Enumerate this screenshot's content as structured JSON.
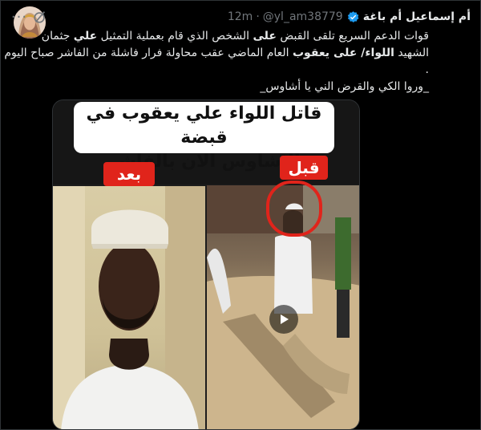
{
  "author": {
    "display_name": "أم إسماعيل أم باغة",
    "handle": "@yl_am38779",
    "separator": "·",
    "time": "12m"
  },
  "icons": {
    "more": "more-icon",
    "grok": "grok-icon",
    "verified": "verified-icon",
    "play": "play-icon"
  },
  "tweet": {
    "lines": [
      [
        "قوات الدعم السريع تلقى القبض ",
        {
          "b": "على"
        },
        " الشخص الذي قام  بعملية التمثيل ",
        {
          "b": "علي"
        },
        " جثمان"
      ],
      [
        "الشهيد ",
        {
          "b": "اللواء/ على يعقوب"
        },
        " العام الماضي عقب محاولة فرار فاشلة من الفاشر صباح اليوم"
      ],
      [
        "."
      ],
      [
        "_وروا الكي والقرض الني يا أشاوس_"
      ]
    ]
  },
  "media": {
    "title_line1": "قاتل اللواء علي يعقوب في قبضة",
    "title_line2": "الاشاوس الان بالفاشر",
    "label_after": "بعد",
    "label_before": "قبل"
  },
  "colors": {
    "background": "#000000",
    "text": "#e7e9ea",
    "muted": "#71767b",
    "verified": "#1d9bf0",
    "label_red": "#e0241b"
  }
}
